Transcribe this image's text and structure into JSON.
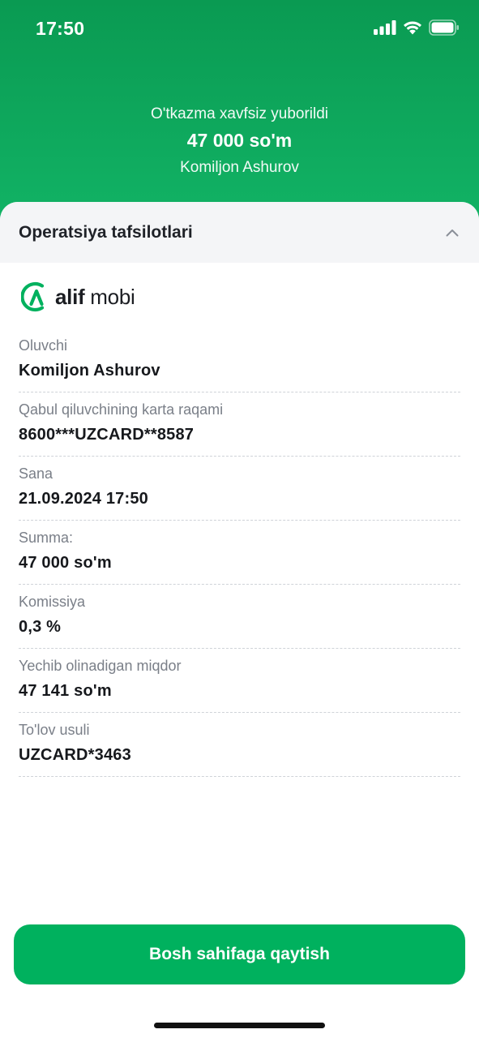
{
  "status_bar": {
    "time": "17:50"
  },
  "hero": {
    "subtitle": "O'tkazma xavfsiz yuborildi",
    "amount": "47 000 so'm",
    "recipient": "Komiljon Ashurov"
  },
  "details": {
    "title": "Operatsiya tafsilotlari",
    "brand": {
      "bold": "alif",
      "regular": " mobi"
    },
    "rows": [
      {
        "label": "Oluvchi",
        "value": "Komiljon Ashurov"
      },
      {
        "label": "Qabul qiluvchining karta raqami",
        "value": "8600***UZCARD**8587"
      },
      {
        "label": "Sana",
        "value": "21.09.2024 17:50"
      },
      {
        "label": "Summa:",
        "value": "47 000 so'm"
      },
      {
        "label": "Komissiya",
        "value": "0,3 %"
      },
      {
        "label": "Yechib olinadigan miqdor",
        "value": "47 141 so'm"
      },
      {
        "label": "To'lov usuli",
        "value": "UZCARD*3463"
      }
    ]
  },
  "actions": {
    "home_label": "Bosh sahifaga qaytish"
  },
  "colors": {
    "brand_green": "#00b15e",
    "header_green": "#0a9a52"
  }
}
